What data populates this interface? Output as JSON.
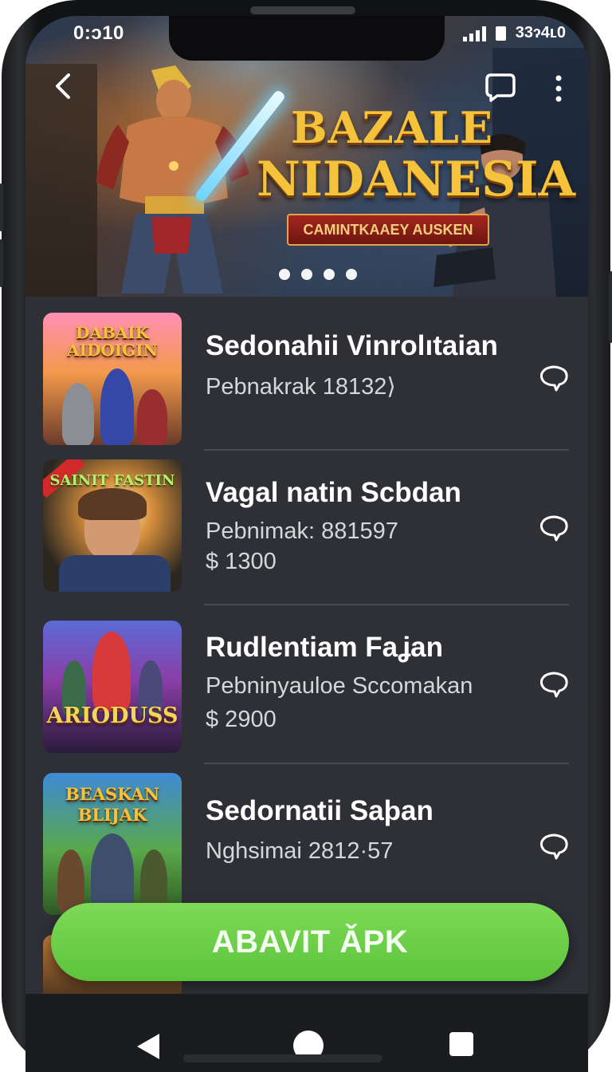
{
  "status_bar": {
    "time": "0:ɔ10",
    "battery_text": "33ɂ4ʟ0"
  },
  "hero": {
    "title_line1": "BAZALE",
    "title_line2": "NIDANESIA",
    "ribbon": "CAMINTKAAEY AUSKEN",
    "carousel_dots": 4,
    "carousel_active_index": 0
  },
  "list": {
    "items": [
      {
        "title": "Sedonahii Vinrolıtaian",
        "subtitle": "Pebnakrak 18132⟩",
        "price": "",
        "thumb_title": "DABAIK AIDOIGIN"
      },
      {
        "title": "Vagal natin Scbdan",
        "subtitle": "Pebnimak: 881597",
        "price": "$ 1300",
        "thumb_title": "SAINIT FASTIN"
      },
      {
        "title": "Rudlentiam Faʝan",
        "subtitle": "Pebninyauloe Sccomakan",
        "price": "$ 2900",
        "thumb_title": "ARIODUSS"
      },
      {
        "title": "Sedornatii Saþan",
        "subtitle": "Nghsimai 2812·57",
        "price": "",
        "thumb_title": "BEASKAN BLIJAK"
      }
    ]
  },
  "cta": {
    "label": "ABAVIT ǍPK",
    "color": "#6bcf47"
  },
  "colors": {
    "background": "#2e3036",
    "text": "#ffffff",
    "subtext": "#d6d7da",
    "accent_gold": "#f5c33b"
  }
}
